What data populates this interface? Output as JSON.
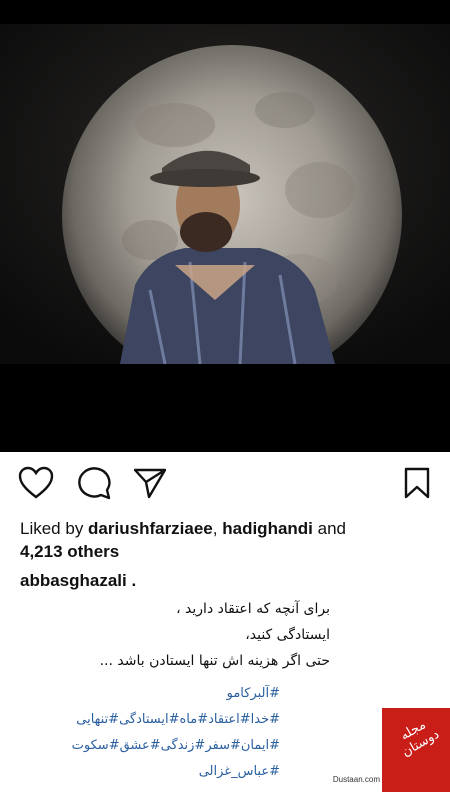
{
  "post": {
    "likes_prefix": "Liked by ",
    "liker1": "dariushfarziaee",
    "sep": ", ",
    "liker2": "hadighandi",
    "and_text": " and",
    "others": "4,213 others",
    "username": "abbasghazali .",
    "caption_lines": [
      "برای آنچه که اعتقاد دارید ،",
      "ایستادگی کنید،",
      "حتی اگر هزینه اش تنها ایستادن باشد ..."
    ],
    "hashtag_lines": [
      "#آلبرکامو",
      "#خدا#اعتقاد#ماه#ایستادگی#تنهایی",
      "#ایمان#سفر#زندگی#عشق#سکوت",
      "#عباس_غزالی"
    ]
  },
  "icons": {
    "like": "heart-icon",
    "comment": "comment-icon",
    "share": "send-icon",
    "save": "bookmark-icon"
  },
  "watermark": {
    "brand": "مجله دوستان",
    "url": "Dustaan.com"
  },
  "colors": {
    "hashtag": "#2a5fa0",
    "watermark_bg": "#c91d18"
  }
}
